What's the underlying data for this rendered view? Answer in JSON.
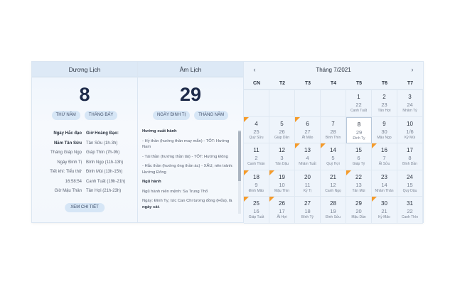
{
  "solar": {
    "title": "Dương Lịch",
    "day": "8",
    "chips": [
      "THỨ NĂM",
      "THÁNG BẢY"
    ],
    "hours": [
      [
        "Ngày Hắc đạo",
        "Giờ Hoàng Đạo:"
      ],
      [
        "Năm Tân Sửu",
        "Tân Sửu (1h-3h)"
      ],
      [
        "Tháng Giáp Ngọ",
        "Giáp Thìn (7h-9h)"
      ],
      [
        "Ngày Đinh Tị",
        "Bính Ngọ (11h-13h)"
      ],
      [
        "Tiết khí: Tiểu thử",
        "Đinh Mùi (13h-15h)"
      ],
      [
        "16:58:54",
        "Canh Tuất (19h-21h)"
      ],
      [
        "Giờ Mậu Thân",
        "Tân Hợi (21h-23h)"
      ]
    ],
    "detail_button": "XEM CHI TIẾT"
  },
  "lunar": {
    "title": "Âm Lịch",
    "day": "29",
    "chips": [
      "NGÀY ĐINH TỊ",
      "THÁNG NĂM"
    ],
    "section1": "Hướng xuất hành",
    "lines": [
      "- Hỷ thần (hướng thần may mắn) - TỐT: Hướng Nam",
      "- Tài thần (hướng thần tài) - TỐT: Hướng Đông",
      "- Hắc thần (hướng ông thần ác) - XẤU, nên tránh: Hướng Đông"
    ],
    "section2": "Ngũ hành",
    "nguhanh1": "Ngũ hành niên mệnh: Sa Trung Thổ",
    "nguhanh2_prefix": "Ngày: Đinh Tỵ; tức Can Chi tương đồng (Hỏa), là ",
    "nguhanh2_bold": "ngày cát",
    "nguhanh2_suffix": "."
  },
  "calendar": {
    "title": "Tháng 7/2021",
    "prev": "‹",
    "next": "›",
    "weekdays": [
      "CN",
      "T2",
      "T3",
      "T4",
      "T5",
      "T6",
      "T7"
    ],
    "marker_color": "#f59b2b",
    "days": [
      {
        "s": "",
        "l": "",
        "c": ""
      },
      {
        "s": "",
        "l": "",
        "c": ""
      },
      {
        "s": "",
        "l": "",
        "c": ""
      },
      {
        "s": "",
        "l": "",
        "c": ""
      },
      {
        "s": "1",
        "l": "22",
        "c": "Canh Tuất"
      },
      {
        "s": "2",
        "l": "23",
        "c": "Tân Hợi"
      },
      {
        "s": "3",
        "l": "24",
        "c": "Nhâm Tý"
      },
      {
        "s": "4",
        "l": "25",
        "c": "Quý Sửu",
        "mark": true
      },
      {
        "s": "5",
        "l": "26",
        "c": "Giáp Dần"
      },
      {
        "s": "6",
        "l": "27",
        "c": "Ất Mão",
        "mark": true
      },
      {
        "s": "7",
        "l": "28",
        "c": "Bính Thìn"
      },
      {
        "s": "8",
        "l": "29",
        "c": "Đinh Tỵ",
        "today": true
      },
      {
        "s": "9",
        "l": "30",
        "c": "Mậu Ngọ"
      },
      {
        "s": "10",
        "l": "1/6",
        "c": "Kỷ Mùi"
      },
      {
        "s": "11",
        "l": "2",
        "c": "Canh Thân"
      },
      {
        "s": "12",
        "l": "3",
        "c": "Tân Dậu"
      },
      {
        "s": "13",
        "l": "4",
        "c": "Nhâm Tuất",
        "mark": true
      },
      {
        "s": "14",
        "l": "5",
        "c": "Quý Hợi",
        "mark": true
      },
      {
        "s": "15",
        "l": "6",
        "c": "Giáp Tý"
      },
      {
        "s": "16",
        "l": "7",
        "c": "Ất Sửu",
        "mark": true
      },
      {
        "s": "17",
        "l": "8",
        "c": "Bính Dần"
      },
      {
        "s": "18",
        "l": "9",
        "c": "Đinh Mão",
        "mark": true
      },
      {
        "s": "19",
        "l": "10",
        "c": "Mậu Thìn",
        "mark": true
      },
      {
        "s": "20",
        "l": "11",
        "c": "Kỷ Tị"
      },
      {
        "s": "21",
        "l": "12",
        "c": "Canh Ngọ"
      },
      {
        "s": "22",
        "l": "13",
        "c": "Tân Mùi",
        "mark": true
      },
      {
        "s": "23",
        "l": "14",
        "c": "Nhâm Thân"
      },
      {
        "s": "24",
        "l": "15",
        "c": "Quý Dậu"
      },
      {
        "s": "25",
        "l": "16",
        "c": "Giáp Tuất",
        "mark": true
      },
      {
        "s": "26",
        "l": "17",
        "c": "Ất Hợi",
        "mark": true
      },
      {
        "s": "27",
        "l": "18",
        "c": "Bính Tý"
      },
      {
        "s": "28",
        "l": "19",
        "c": "Đinh Sửu"
      },
      {
        "s": "29",
        "l": "20",
        "c": "Mậu Dần"
      },
      {
        "s": "30",
        "l": "21",
        "c": "Kỷ Mão",
        "mark": true
      },
      {
        "s": "31",
        "l": "22",
        "c": "Canh Thìn"
      }
    ]
  }
}
